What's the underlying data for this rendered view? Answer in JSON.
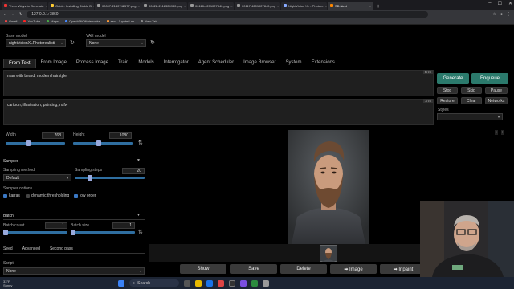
{
  "browser": {
    "tabs": [
      {
        "title": "Three Ways to Generate",
        "color": "#e33"
      },
      {
        "title": "Guide: Installing Stable D",
        "color": "#fc3"
      },
      {
        "title": "00007-2140742577.png",
        "color": "#999"
      },
      {
        "title": "00022-2112324980.png",
        "color": "#999"
      },
      {
        "title": "00118-4201027840.png",
        "color": "#999"
      },
      {
        "title": "00117-4201027840.png",
        "color": "#999"
      },
      {
        "title": "NightVision XL - Photore",
        "color": "#8af"
      },
      {
        "title": "SD.Next",
        "color": "#f80"
      }
    ],
    "url": "127.0.0.1:7860",
    "bookmarks": [
      {
        "label": "Gmail",
        "color": "#e44"
      },
      {
        "label": "YouTube",
        "color": "#f22"
      },
      {
        "label": "Maps",
        "color": "#4a4"
      },
      {
        "label": "OpenVINONotebooks",
        "color": "#48f"
      },
      {
        "label": "sec - JupyterLab",
        "color": "#f93"
      },
      {
        "label": "New Tab",
        "color": "#888"
      }
    ]
  },
  "models": {
    "base_label": "Base model",
    "base_value": "nightvisionXLPhotorealisti",
    "vae_label": "VAE model",
    "vae_value": "None"
  },
  "main_tabs": [
    "From Text",
    "From Image",
    "Process Image",
    "Train",
    "Models",
    "Interrogator",
    "Agent Scheduler",
    "Image Browser",
    "System",
    "Extensions"
  ],
  "prompt": {
    "text": "man with beard, modern hairstyle",
    "counter": "6/75"
  },
  "negative_prompt": {
    "text": "cartoon, illustration, painting, nsfw",
    "counter": "7/75"
  },
  "actions": {
    "generate": "Generate",
    "enqueue": "Enqueue",
    "stop": "Stop",
    "skip": "Skip",
    "pause": "Pause",
    "restore": "Restore",
    "clear": "Clear",
    "networks": "Networks",
    "styles_label": "Styles"
  },
  "size": {
    "width_label": "Width",
    "width_value": "768",
    "height_label": "Height",
    "height_value": "1080",
    "width_fraction": 0.37,
    "height_fraction": 0.42
  },
  "sampler": {
    "section": "Sampler",
    "method_label": "Sampling method",
    "method_value": "Default",
    "steps_label": "Sampling steps",
    "steps_value": "20",
    "steps_fraction": 0.2,
    "options_label": "Sampler options",
    "options": [
      {
        "label": "karras",
        "checked": true
      },
      {
        "label": "dynamic thresholding",
        "checked": false
      },
      {
        "label": "low order",
        "checked": true
      }
    ]
  },
  "batch": {
    "section": "Batch",
    "count_label": "Batch count",
    "count_value": "1",
    "size_label": "Batch size",
    "size_value": "1"
  },
  "seed_tabs": [
    "Seed",
    "Advanced",
    "Second pass"
  ],
  "script": {
    "label": "Script",
    "value": "None"
  },
  "output_buttons": [
    "Show",
    "Save",
    "Delete",
    "➡ Image",
    "➡ Inpaint"
  ],
  "taskbar": {
    "weather_temp": "33°F",
    "weather_desc": "Sunny",
    "search": "Search"
  }
}
